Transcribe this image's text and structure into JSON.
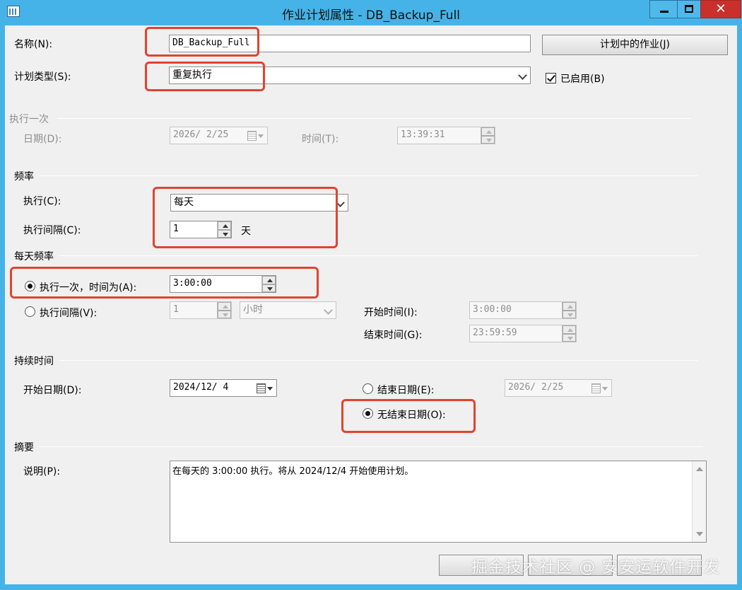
{
  "window": {
    "title": "作业计划属性 - DB_Backup_Full",
    "close_glyph": "✕",
    "accent_titlebar": "#45b3e7",
    "close_color": "#c9302c",
    "highlight_color": "#e2432e"
  },
  "general": {
    "name_label": "名称(N):",
    "name_value": "DB_Backup_Full",
    "jobs_button": "计划中的作业(J)",
    "schedule_type_label": "计划类型(S):",
    "schedule_type_value": "重复执行",
    "enabled_label": "已启用(B)",
    "enabled": true
  },
  "one_time": {
    "section": "执行一次",
    "date_label": "日期(D):",
    "date_value": "2026/ 2/25",
    "time_label": "时间(T):",
    "time_value": "13:39:31"
  },
  "frequency": {
    "section": "频率",
    "occurs_label": "执行(C):",
    "occurs_value": "每天",
    "recurs_label": "执行间隔(C):",
    "recurs_value": "1",
    "recurs_unit": "天"
  },
  "daily_frequency": {
    "section": "每天频率",
    "once_label": "执行一次，时间为(A):",
    "once_selected": true,
    "once_time": "3:00:00",
    "every_label": "执行间隔(V):",
    "every_value": "1",
    "every_unit": "小时",
    "start_label": "开始时间(I):",
    "start_value": "3:00:00",
    "end_label": "结束时间(G):",
    "end_value": "23:59:59"
  },
  "duration": {
    "section": "持续时间",
    "start_date_label": "开始日期(D):",
    "start_date_value": "2024/12/ 4",
    "end_date_label": "结束日期(E):",
    "end_date_value": "2026/ 2/25",
    "no_end_label": "无结束日期(O):",
    "no_end_selected": true
  },
  "summary": {
    "section": "摘要",
    "desc_label": "说明(P):",
    "desc_value": "在每天的 3:00:00 执行。将从 2024/12/4 开始使用计划。"
  },
  "footer": {
    "watermark": "掘金技术社区 @ 安安运软件开发"
  },
  "icons": [
    "window-icon",
    "minimize-icon",
    "maximize-icon",
    "close-icon",
    "chevron-down-icon",
    "calendar-icon",
    "spin-up-icon",
    "spin-down-icon",
    "scroll-up-icon",
    "scroll-down-icon",
    "checkbox-icon",
    "radio-icon"
  ]
}
